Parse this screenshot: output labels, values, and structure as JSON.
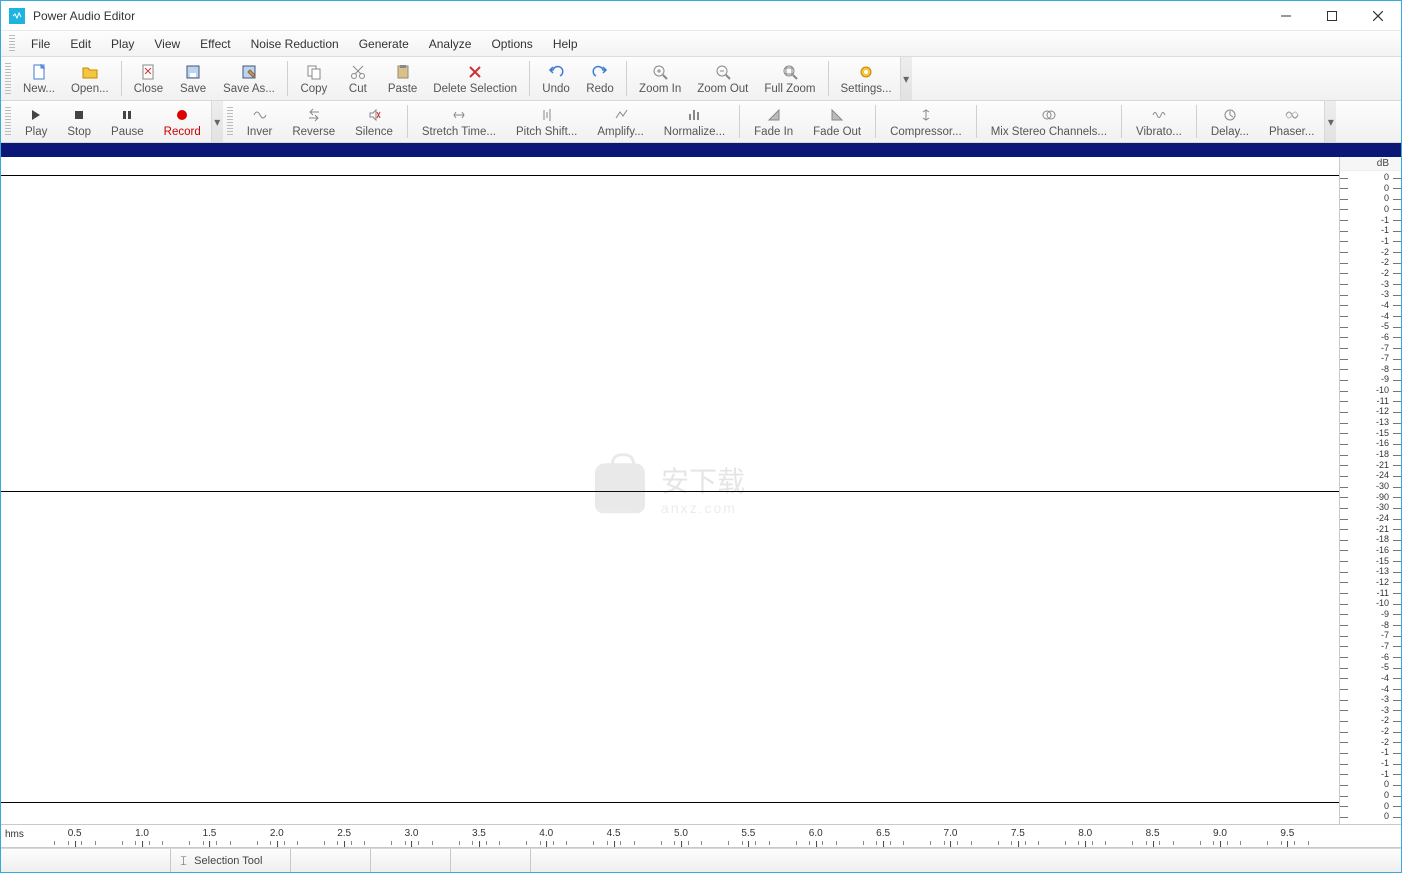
{
  "window": {
    "title": "Power Audio Editor"
  },
  "menu": {
    "items": [
      "File",
      "Edit",
      "Play",
      "View",
      "Effect",
      "Noise Reduction",
      "Generate",
      "Analyze",
      "Options",
      "Help"
    ]
  },
  "toolbar_main": {
    "new": "New...",
    "open": "Open...",
    "close": "Close",
    "save": "Save",
    "save_as": "Save As...",
    "copy": "Copy",
    "cut": "Cut",
    "paste": "Paste",
    "delete_selection": "Delete Selection",
    "undo": "Undo",
    "redo": "Redo",
    "zoom_in": "Zoom In",
    "zoom_out": "Zoom Out",
    "full_zoom": "Full Zoom",
    "settings": "Settings..."
  },
  "toolbar_playback": {
    "play": "Play",
    "stop": "Stop",
    "pause": "Pause",
    "record": "Record"
  },
  "toolbar_effects": {
    "inver": "Inver",
    "reverse": "Reverse",
    "silence": "Silence",
    "stretch": "Stretch Time...",
    "pitch": "Pitch Shift...",
    "amplify": "Amplify...",
    "normalize": "Normalize...",
    "fade_in": "Fade In",
    "fade_out": "Fade Out",
    "compressor": "Compressor...",
    "mix_stereo": "Mix Stereo Channels...",
    "vibrato": "Vibrato...",
    "delay": "Delay...",
    "phaser": "Phaser..."
  },
  "db_ruler": {
    "label": "dB",
    "values_upper": [
      "0",
      "0",
      "0",
      "0",
      "-1",
      "-1",
      "-1",
      "-2",
      "-2",
      "-2",
      "-3",
      "-3",
      "-4",
      "-4",
      "-5",
      "-6",
      "-7",
      "-7",
      "-8",
      "-9",
      "-10",
      "-11",
      "-12",
      "-13",
      "-15",
      "-16",
      "-18",
      "-21",
      "-24",
      "-30",
      "-90"
    ],
    "values_lower": [
      "-30",
      "-24",
      "-21",
      "-18",
      "-16",
      "-15",
      "-13",
      "-12",
      "-11",
      "-10",
      "-9",
      "-8",
      "-7",
      "-7",
      "-6",
      "-5",
      "-4",
      "-4",
      "-3",
      "-3",
      "-2",
      "-2",
      "-2",
      "-1",
      "-1",
      "-1",
      "0",
      "0",
      "0",
      "0"
    ]
  },
  "time_ruler": {
    "unit": "hms",
    "majors": [
      "0.5",
      "1.0",
      "1.5",
      "2.0",
      "2.5",
      "3.0",
      "3.5",
      "4.0",
      "4.5",
      "5.0",
      "5.5",
      "6.0",
      "6.5",
      "7.0",
      "7.5",
      "8.0",
      "8.5",
      "9.0",
      "9.5"
    ]
  },
  "statusbar": {
    "tool": "Selection Tool"
  },
  "watermark": {
    "text": "安下载",
    "sub": "anxz.com"
  }
}
